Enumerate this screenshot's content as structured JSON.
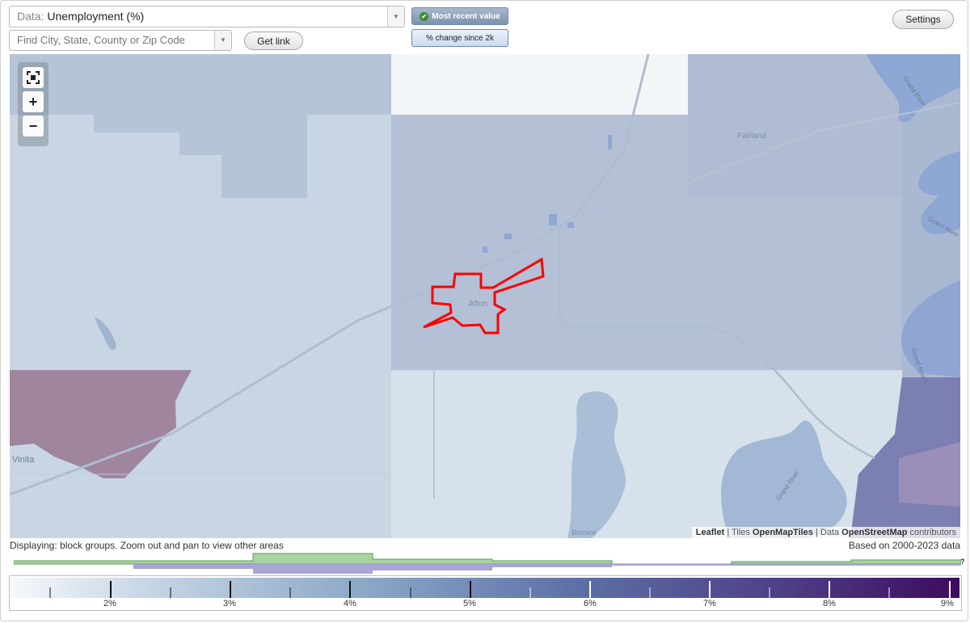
{
  "data_select": {
    "prefix": "Data:",
    "value": "Unemployment (%)"
  },
  "search": {
    "placeholder": "Find City, State, County or Zip Code"
  },
  "buttons": {
    "get_link": "Get link",
    "settings": "Settings",
    "most_recent": "Most recent value",
    "percent_change": "% change since 2k"
  },
  "map": {
    "place_labels": {
      "afton": "Afton",
      "fairland": "Fairland",
      "vinita": "Vinita",
      "bernice": "Bernice"
    },
    "water_labels": {
      "grand_river_1": "Grand River",
      "grand_river_2": "Grand River",
      "grand_river_3": "Grand River",
      "grand_river_4": "Grand River"
    },
    "highlight_color": "#ff0000",
    "icons": [
      "fullscreen-icon",
      "zoom-in-icon",
      "zoom-out-icon"
    ],
    "attribution": {
      "leaflet": "Leaflet",
      "sep1": " | Tiles ",
      "tiles": "OpenMapTiles",
      "sep2": " | Data ",
      "data": "OpenStreetMap",
      "contributors": " contributors"
    }
  },
  "status": {
    "display_note": "Displaying: block groups. Zoom out and pan to view other areas",
    "based_on": "Based on 2000-2023 data"
  },
  "legend": {
    "labels": [
      "2%",
      "3%",
      "4%",
      "5%",
      "6%",
      "7%",
      "8%",
      "9%"
    ],
    "help": "?"
  }
}
